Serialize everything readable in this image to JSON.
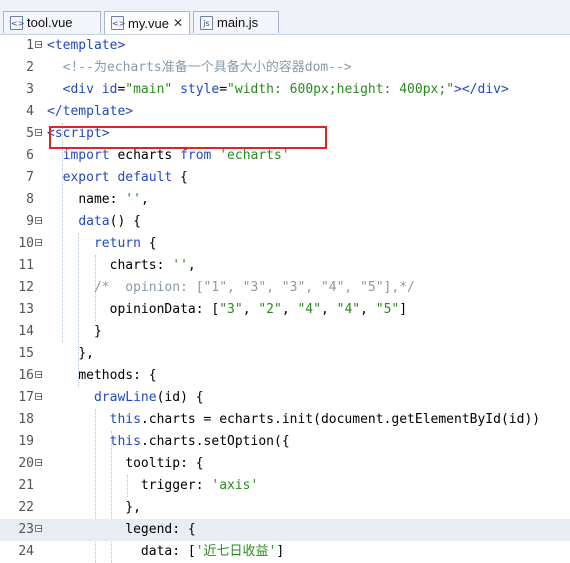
{
  "tabs": [
    {
      "name": "tool.vue",
      "icon": "vue-file-icon",
      "active": false
    },
    {
      "name": "my.vue",
      "icon": "vue-file-icon",
      "active": true,
      "close": "✕"
    },
    {
      "name": "main.js",
      "icon": "js-file-icon",
      "active": false
    }
  ],
  "highlight_color": "#e02424",
  "lines": [
    {
      "n": "1",
      "fold": "−",
      "tokens": [
        [
          "tag",
          "<template>"
        ]
      ]
    },
    {
      "n": "2",
      "tokens": [
        [
          "pad",
          "  "
        ],
        [
          "cm",
          "<!--为echarts准备一个具备大小的容器dom-->"
        ]
      ]
    },
    {
      "n": "3",
      "tokens": [
        [
          "pad",
          "  "
        ],
        [
          "tag",
          "<div "
        ],
        [
          "attr",
          "id"
        ],
        [
          "plain",
          "="
        ],
        [
          "str",
          "\"main\""
        ],
        [
          "plain",
          " "
        ],
        [
          "attr",
          "style"
        ],
        [
          "plain",
          "="
        ],
        [
          "str",
          "\"width: 600px;height: 400px;\""
        ],
        [
          "tag",
          "></div>"
        ]
      ]
    },
    {
      "n": "4",
      "tokens": [
        [
          "tag",
          "</template>"
        ]
      ]
    },
    {
      "n": "5",
      "fold": "−",
      "tokens": [
        [
          "tag",
          "<script>"
        ]
      ]
    },
    {
      "n": "6",
      "tokens": [
        [
          "pad",
          "  "
        ],
        [
          "kw",
          "import"
        ],
        [
          "plain",
          " echarts "
        ],
        [
          "kw",
          "from"
        ],
        [
          "plain",
          " "
        ],
        [
          "str",
          "'echarts'"
        ]
      ]
    },
    {
      "n": "7",
      "tokens": [
        [
          "pad",
          "  "
        ],
        [
          "kw",
          "export default"
        ],
        [
          "plain",
          " {"
        ]
      ]
    },
    {
      "n": "8",
      "tokens": [
        [
          "pad",
          "    "
        ],
        [
          "plain",
          "name: "
        ],
        [
          "str",
          "''"
        ],
        [
          "plain",
          ","
        ]
      ]
    },
    {
      "n": "9",
      "fold": "−",
      "tokens": [
        [
          "pad",
          "    "
        ],
        [
          "kw",
          "data"
        ],
        [
          "plain",
          "() {"
        ]
      ]
    },
    {
      "n": "10",
      "fold": "−",
      "tokens": [
        [
          "pad",
          "      "
        ],
        [
          "kw",
          "return"
        ],
        [
          "plain",
          " {"
        ]
      ]
    },
    {
      "n": "11",
      "tokens": [
        [
          "pad",
          "        "
        ],
        [
          "plain",
          "charts: "
        ],
        [
          "str",
          "''"
        ],
        [
          "plain",
          ","
        ]
      ]
    },
    {
      "n": "12",
      "tokens": [
        [
          "pad",
          "      "
        ],
        [
          "cm",
          "/*  opinion: [\"1\", \"3\", \"3\", \"4\", \"5\"],*/"
        ]
      ]
    },
    {
      "n": "13",
      "tokens": [
        [
          "pad",
          "        "
        ],
        [
          "plain",
          "opinionData: ["
        ],
        [
          "str",
          "\"3\""
        ],
        [
          "plain",
          ", "
        ],
        [
          "str",
          "\"2\""
        ],
        [
          "plain",
          ", "
        ],
        [
          "str",
          "\"4\""
        ],
        [
          "plain",
          ", "
        ],
        [
          "str",
          "\"4\""
        ],
        [
          "plain",
          ", "
        ],
        [
          "str",
          "\"5\""
        ],
        [
          "plain",
          "]"
        ]
      ]
    },
    {
      "n": "14",
      "tokens": [
        [
          "pad",
          "      "
        ],
        [
          "plain",
          "}"
        ]
      ]
    },
    {
      "n": "15",
      "tokens": [
        [
          "pad",
          "    "
        ],
        [
          "plain",
          "},"
        ]
      ]
    },
    {
      "n": "16",
      "fold": "−",
      "tokens": [
        [
          "pad",
          "    "
        ],
        [
          "plain",
          "methods: {"
        ]
      ]
    },
    {
      "n": "17",
      "fold": "−",
      "tokens": [
        [
          "pad",
          "      "
        ],
        [
          "kw",
          "drawLine"
        ],
        [
          "plain",
          "(id) {"
        ]
      ]
    },
    {
      "n": "18",
      "tokens": [
        [
          "pad",
          "        "
        ],
        [
          "kw",
          "this"
        ],
        [
          "plain",
          ".charts = echarts.init(document.getElementById(id))"
        ]
      ]
    },
    {
      "n": "19",
      "tokens": [
        [
          "pad",
          "        "
        ],
        [
          "kw",
          "this"
        ],
        [
          "plain",
          ".charts.setOption({"
        ]
      ]
    },
    {
      "n": "20",
      "fold": "−",
      "tokens": [
        [
          "pad",
          "          "
        ],
        [
          "plain",
          "tooltip: {"
        ]
      ]
    },
    {
      "n": "21",
      "tokens": [
        [
          "pad",
          "            "
        ],
        [
          "plain",
          "trigger: "
        ],
        [
          "str",
          "'axis'"
        ]
      ]
    },
    {
      "n": "22",
      "tokens": [
        [
          "pad",
          "          "
        ],
        [
          "plain",
          "},"
        ]
      ]
    },
    {
      "n": "23",
      "fold": "−",
      "highlight": true,
      "tokens": [
        [
          "pad",
          "          "
        ],
        [
          "plain",
          "legend: {"
        ]
      ]
    },
    {
      "n": "24",
      "tokens": [
        [
          "pad",
          "            "
        ],
        [
          "plain",
          "data: ["
        ],
        [
          "str",
          "'近七日收益'"
        ],
        [
          "plain",
          "]"
        ]
      ]
    }
  ]
}
